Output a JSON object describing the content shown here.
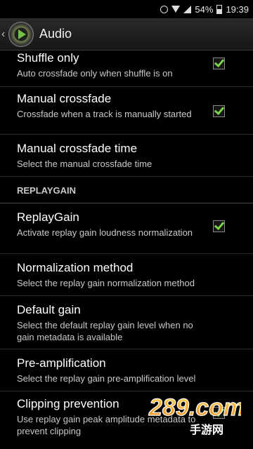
{
  "status_bar": {
    "battery": "54%",
    "time": "19:39",
    "icons": [
      "alarm-icon",
      "wifi-icon",
      "signal-icon",
      "battery-icon"
    ]
  },
  "app_bar": {
    "title": "Audio",
    "icons": [
      "back-chevron-icon",
      "app-logo-icon"
    ]
  },
  "settings": {
    "shuffle_only": {
      "title": "Shuffle only",
      "summary": "Auto crossfade only when shuffle is on",
      "checked": true
    },
    "manual_crossfade": {
      "title": "Manual crossfade",
      "summary": "Crossfade when a track is manually started",
      "checked": true
    },
    "manual_crossfade_time": {
      "title": "Manual crossfade time",
      "summary": "Select the manual crossfade time"
    },
    "replaygain_section": "REPLAYGAIN",
    "replaygain": {
      "title": "ReplayGain",
      "summary": "Activate replay gain loudness normalization",
      "checked": true
    },
    "normalization_method": {
      "title": "Normalization method",
      "summary": "Select the replay gain normalization method"
    },
    "default_gain": {
      "title": "Default gain",
      "summary": "Select the default replay gain level when no gain metadata is available"
    },
    "pre_amplification": {
      "title": "Pre-amplification",
      "summary": "Select the replay gain pre-amplification level"
    },
    "clipping_prevention": {
      "title": "Clipping prevention",
      "summary": "Use replay gain peak amplitude metadata to prevent clipping",
      "checked": true
    }
  },
  "watermark": {
    "text": "289.com",
    "subtext": "手游网"
  },
  "colors": {
    "check": "#7ad14c",
    "background": "#000000",
    "summary_text": "#c9c9c9"
  }
}
